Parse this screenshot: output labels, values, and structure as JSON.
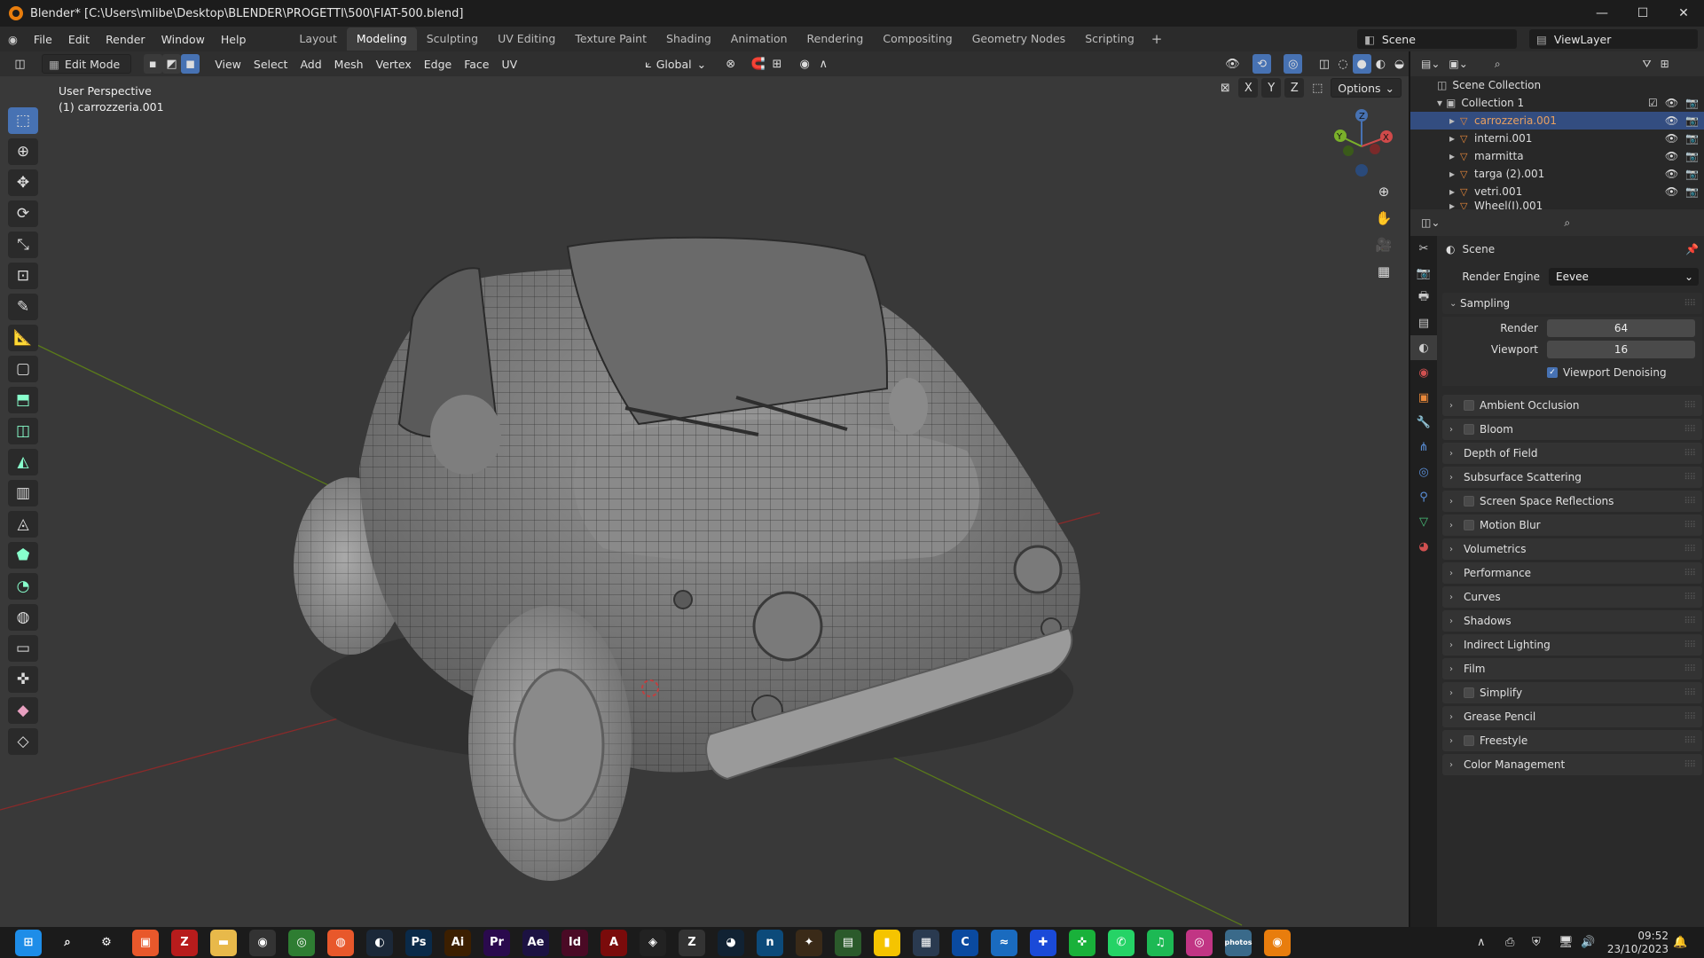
{
  "window": {
    "title": "Blender* [C:\\Users\\mlibe\\Desktop\\BLENDER\\PROGETTI\\500\\FIAT-500.blend]",
    "minimize": "—",
    "maximize": "☐",
    "close": "✕"
  },
  "menu": {
    "items": [
      "File",
      "Edit",
      "Render",
      "Window",
      "Help"
    ]
  },
  "workspaces": {
    "tabs": [
      "Layout",
      "Modeling",
      "Sculpting",
      "UV Editing",
      "Texture Paint",
      "Shading",
      "Animation",
      "Rendering",
      "Compositing",
      "Geometry Nodes",
      "Scripting"
    ],
    "active": "Modeling",
    "add": "+"
  },
  "scene": {
    "name": "Scene",
    "viewlayer": "ViewLayer"
  },
  "viewport_header": {
    "mode": "Edit Mode",
    "menus": [
      "View",
      "Select",
      "Add",
      "Mesh",
      "Vertex",
      "Edge",
      "Face",
      "UV"
    ],
    "transform": "Global",
    "options": "Options",
    "axes": [
      "X",
      "Y",
      "Z"
    ]
  },
  "viewport": {
    "perspective": "User Perspective",
    "object": "(1) carrozzeria.001"
  },
  "gizmo": {
    "z": "Z",
    "x": "X",
    "y": "Y"
  },
  "outliner": {
    "root": "Scene Collection",
    "collection": "Collection 1",
    "items": [
      {
        "name": "carrozzeria.001",
        "selected": true
      },
      {
        "name": "interni.001",
        "selected": false
      },
      {
        "name": "marmitta",
        "selected": false
      },
      {
        "name": "targa (2).001",
        "selected": false
      },
      {
        "name": "vetri.001",
        "selected": false
      },
      {
        "name": "Wheel(I).001",
        "selected": false
      }
    ]
  },
  "properties": {
    "context": "Scene",
    "render_engine_label": "Render Engine",
    "render_engine": "Eevee",
    "sampling": {
      "title": "Sampling",
      "render_label": "Render",
      "render": "64",
      "viewport_label": "Viewport",
      "viewport": "16",
      "denoise": "Viewport Denoising"
    },
    "panels": [
      {
        "label": "Ambient Occlusion",
        "checkbox": true
      },
      {
        "label": "Bloom",
        "checkbox": true
      },
      {
        "label": "Depth of Field",
        "checkbox": false
      },
      {
        "label": "Subsurface Scattering",
        "checkbox": false
      },
      {
        "label": "Screen Space Reflections",
        "checkbox": true
      },
      {
        "label": "Motion Blur",
        "checkbox": true
      },
      {
        "label": "Volumetrics",
        "checkbox": false
      },
      {
        "label": "Performance",
        "checkbox": false
      },
      {
        "label": "Curves",
        "checkbox": false
      },
      {
        "label": "Shadows",
        "checkbox": false
      },
      {
        "label": "Indirect Lighting",
        "checkbox": false
      },
      {
        "label": "Film",
        "checkbox": false
      },
      {
        "label": "Simplify",
        "checkbox": true
      },
      {
        "label": "Grease Pencil",
        "checkbox": false
      },
      {
        "label": "Freestyle",
        "checkbox": true
      },
      {
        "label": "Color Management",
        "checkbox": false
      }
    ]
  },
  "taskbar": {
    "apps": [
      {
        "name": "start",
        "label": "⊞",
        "color": "#1e8de8"
      },
      {
        "name": "search",
        "label": "⌕",
        "color": "transparent"
      },
      {
        "name": "settings",
        "label": "⚙",
        "color": "transparent"
      },
      {
        "name": "app-orange",
        "label": "▣",
        "color": "#e8582b"
      },
      {
        "name": "filezilla",
        "label": "Z",
        "color": "#b71c1c"
      },
      {
        "name": "explorer",
        "label": "▬",
        "color": "#e8b94a"
      },
      {
        "name": "blender-a",
        "label": "◉",
        "color": "#333"
      },
      {
        "name": "chrome",
        "label": "◎",
        "color": "#2e7d32"
      },
      {
        "name": "firefox",
        "label": "◍",
        "color": "#e8582b"
      },
      {
        "name": "steam",
        "label": "◐",
        "color": "#1b2838"
      },
      {
        "name": "photoshop",
        "label": "Ps",
        "color": "#0a2a49"
      },
      {
        "name": "illustrator",
        "label": "Ai",
        "color": "#3c1f00"
      },
      {
        "name": "premiere",
        "label": "Pr",
        "color": "#2a0a4d"
      },
      {
        "name": "after-effects",
        "label": "Ae",
        "color": "#1c1242"
      },
      {
        "name": "indesign",
        "label": "Id",
        "color": "#4a0a25"
      },
      {
        "name": "acrobat",
        "label": "A",
        "color": "#7a0b0b"
      },
      {
        "name": "unity",
        "label": "◈",
        "color": "#222"
      },
      {
        "name": "zbrush",
        "label": "Z",
        "color": "#333"
      },
      {
        "name": "app-blue",
        "label": "◕",
        "color": "#123"
      },
      {
        "name": "app-n",
        "label": "n",
        "color": "#0c4a7a"
      },
      {
        "name": "app-bug",
        "label": "✦",
        "color": "#3a2a18"
      },
      {
        "name": "app-chart",
        "label": "▤",
        "color": "#2b5a2b"
      },
      {
        "name": "sticky",
        "label": "▮",
        "color": "#f5c400"
      },
      {
        "name": "calculator",
        "label": "▦",
        "color": "#2a3a50"
      },
      {
        "name": "app-c",
        "label": "C",
        "color": "#0a4aa0"
      },
      {
        "name": "app-wave",
        "label": "≈",
        "color": "#1a6bbf"
      },
      {
        "name": "app-dots",
        "label": "✚",
        "color": "#1a4ad8"
      },
      {
        "name": "app-green",
        "label": "✜",
        "color": "#19b13a"
      },
      {
        "name": "whatsapp",
        "label": "✆",
        "color": "#25d366"
      },
      {
        "name": "spotify",
        "label": "♫",
        "color": "#1db954"
      },
      {
        "name": "instagram",
        "label": "◎",
        "color": "#c13584"
      },
      {
        "name": "photos",
        "label": "photos",
        "color": "#3a6a8a"
      },
      {
        "name": "blender",
        "label": "◉",
        "color": "#e87d0d"
      }
    ],
    "time": "09:52",
    "date": "23/10/2023"
  },
  "colors": {
    "accent": "#4772b3",
    "viewport_bg": "#393939",
    "object_orange": "#e8883a",
    "grid_red": "#8a2a2a",
    "grid_green": "#5a7a1a"
  }
}
